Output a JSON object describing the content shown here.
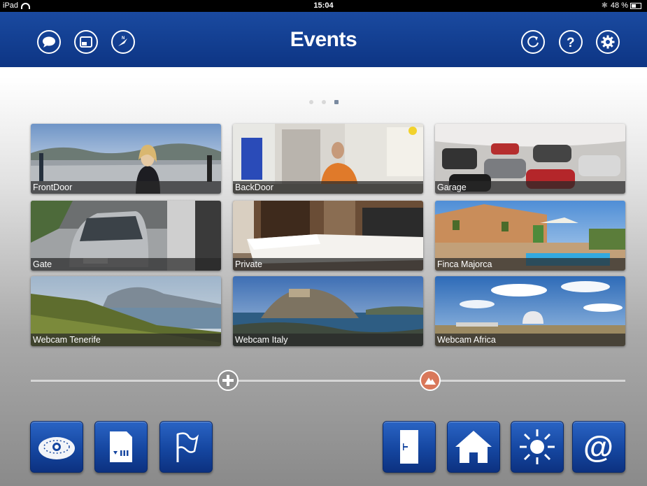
{
  "status_bar": {
    "device": "iPad",
    "time": "15:04",
    "battery": "48 %"
  },
  "header": {
    "title": "Events",
    "left_buttons": [
      "chat-bubble-icon",
      "window-icon",
      "compass-icon"
    ],
    "right_buttons": [
      "refresh-icon",
      "help-icon",
      "settings-icon"
    ]
  },
  "pager": {
    "pages": 3,
    "current": 3
  },
  "cameras": [
    {
      "label": "FrontDoor"
    },
    {
      "label": "BackDoor"
    },
    {
      "label": "Garage"
    },
    {
      "label": "Gate"
    },
    {
      "label": "Private"
    },
    {
      "label": "Finca Majorca"
    },
    {
      "label": "Webcam Tenerife"
    },
    {
      "label": "Webcam Italy"
    },
    {
      "label": "Webcam Africa"
    }
  ],
  "slider": {
    "left_handle": "plus-icon",
    "right_handle": "mountain-icon"
  },
  "toolbar": {
    "left": [
      "camera-dome-icon",
      "sd-card-icon",
      "flag-icon"
    ],
    "right": [
      "door-icon",
      "home-icon",
      "sun-icon",
      "at-sign-icon"
    ]
  },
  "colors": {
    "header_blue": "#1546a0",
    "accent_orange": "#d9785a"
  }
}
